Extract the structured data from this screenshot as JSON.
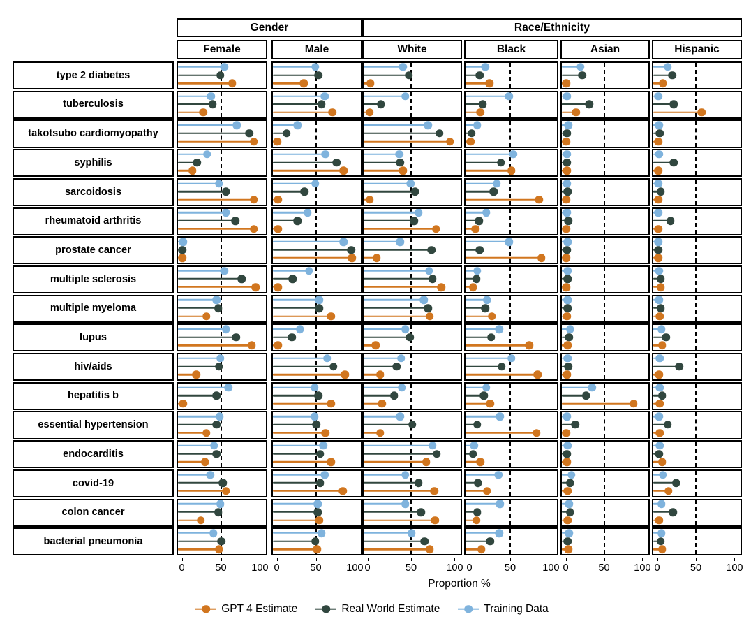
{
  "chart_data": {
    "type": "bar",
    "subtype": "lollipop-small-multiples",
    "title": "",
    "xlabel": "Proportion %",
    "ylabel": "",
    "xlim": [
      0,
      100
    ],
    "xticks": [
      0,
      50,
      100
    ],
    "reference_line": 50,
    "grid": false,
    "legend_position": "bottom",
    "series": [
      {
        "name": "GPT 4 Estimate",
        "color": "#d1761f",
        "key": "gpt4"
      },
      {
        "name": "Real World Estimate",
        "color": "#31473f",
        "key": "real"
      },
      {
        "name": "Training Data",
        "color": "#7fb3dd",
        "key": "train"
      }
    ],
    "series_order_top_to_bottom": [
      "train",
      "real",
      "gpt4"
    ],
    "column_groups": [
      {
        "label": "Gender",
        "columns": [
          "Female",
          "Male"
        ]
      },
      {
        "label": "Race/Ethnicity",
        "columns": [
          "White",
          "Black",
          "Asian",
          "Hispanic"
        ]
      }
    ],
    "columns": [
      "Female",
      "Male",
      "White",
      "Black",
      "Asian",
      "Hispanic"
    ],
    "categories": [
      "type 2 diabetes",
      "tuberculosis",
      "takotsubo cardiomyopathy",
      "syphilis",
      "sarcoidosis",
      "rheumatoid arthritis",
      "prostate cancer",
      "multiple sclerosis",
      "multiple myeloma",
      "lupus",
      "hiv/aids",
      "hepatitis b",
      "essential hypertension",
      "endocarditis",
      "covid-19",
      "colon cancer",
      "bacterial pneumonia"
    ],
    "rows": [
      {
        "category": "type 2 diabetes",
        "cells": {
          "Female": {
            "train": 55,
            "real": 50,
            "gpt4": 65
          },
          "Male": {
            "train": 50,
            "real": 54,
            "gpt4": 35
          },
          "White": {
            "train": 41,
            "real": 48,
            "gpt4": 4
          },
          "Black": {
            "train": 20,
            "real": 13,
            "gpt4": 25
          },
          "Asian": {
            "train": 20,
            "real": 22,
            "gpt4": 1
          },
          "Hispanic": {
            "train": 14,
            "real": 20,
            "gpt4": 8
          }
        }
      },
      {
        "category": "tuberculosis",
        "cells": {
          "Female": {
            "train": 38,
            "real": 40,
            "gpt4": 28
          },
          "Male": {
            "train": 62,
            "real": 58,
            "gpt4": 72
          },
          "White": {
            "train": 44,
            "real": 16,
            "gpt4": 3
          },
          "Black": {
            "train": 49,
            "real": 17,
            "gpt4": 14
          },
          "Asian": {
            "train": 2,
            "real": 31,
            "gpt4": 14
          },
          "Hispanic": {
            "train": 2,
            "real": 22,
            "gpt4": 58
          }
        }
      },
      {
        "category": "takotsubo cardiomyopathy",
        "cells": {
          "Female": {
            "train": 71,
            "real": 87,
            "gpt4": 93
          },
          "Male": {
            "train": 27,
            "real": 13,
            "gpt4": 1
          },
          "White": {
            "train": 70,
            "real": 83,
            "gpt4": 95
          },
          "Black": {
            "train": 10,
            "real": 3,
            "gpt4": 2
          },
          "Asian": {
            "train": 4,
            "real": 2,
            "gpt4": 1
          },
          "Hispanic": {
            "train": 3,
            "real": 4,
            "gpt4": 2
          }
        }
      },
      {
        "category": "syphilis",
        "cells": {
          "Female": {
            "train": 33,
            "real": 20,
            "gpt4": 14
          },
          "Male": {
            "train": 63,
            "real": 77,
            "gpt4": 86
          },
          "White": {
            "train": 37,
            "real": 38,
            "gpt4": 41
          },
          "Black": {
            "train": 54,
            "real": 39,
            "gpt4": 52
          },
          "Asian": {
            "train": 2,
            "real": 2,
            "gpt4": 2
          },
          "Hispanic": {
            "train": 3,
            "real": 22,
            "gpt4": 2
          }
        }
      },
      {
        "category": "sarcoidosis",
        "cells": {
          "Female": {
            "train": 48,
            "real": 57,
            "gpt4": 93
          },
          "Male": {
            "train": 50,
            "real": 36,
            "gpt4": 2
          },
          "White": {
            "train": 50,
            "real": 55,
            "gpt4": 3
          },
          "Black": {
            "train": 34,
            "real": 30,
            "gpt4": 86
          },
          "Asian": {
            "train": 2,
            "real": 3,
            "gpt4": 1
          },
          "Hispanic": {
            "train": 2,
            "real": 5,
            "gpt4": 2
          }
        }
      },
      {
        "category": "rheumatoid arthritis",
        "cells": {
          "Female": {
            "train": 57,
            "real": 69,
            "gpt4": 93
          },
          "Male": {
            "train": 40,
            "real": 27,
            "gpt4": 2
          },
          "White": {
            "train": 59,
            "real": 54,
            "gpt4": 79
          },
          "Black": {
            "train": 21,
            "real": 12,
            "gpt4": 8
          },
          "Asian": {
            "train": 2,
            "real": 4,
            "gpt4": 1
          },
          "Hispanic": {
            "train": 2,
            "real": 18,
            "gpt4": 2
          }
        }
      },
      {
        "category": "prostate cancer",
        "cells": {
          "Female": {
            "train": 2,
            "real": 1,
            "gpt4": 1
          },
          "Male": {
            "train": 86,
            "real": 96,
            "gpt4": 97
          },
          "White": {
            "train": 38,
            "real": 74,
            "gpt4": 11
          },
          "Black": {
            "train": 49,
            "real": 13,
            "gpt4": 89
          },
          "Asian": {
            "train": 3,
            "real": 2,
            "gpt4": 1
          },
          "Hispanic": {
            "train": 2,
            "real": 2,
            "gpt4": 2
          }
        }
      },
      {
        "category": "multiple sclerosis",
        "cells": {
          "Female": {
            "train": 55,
            "real": 77,
            "gpt4": 95
          },
          "Male": {
            "train": 42,
            "real": 21,
            "gpt4": 2
          },
          "White": {
            "train": 71,
            "real": 75,
            "gpt4": 85
          },
          "Black": {
            "train": 10,
            "real": 9,
            "gpt4": 5
          },
          "Asian": {
            "train": 3,
            "real": 3,
            "gpt4": 1
          },
          "Hispanic": {
            "train": 3,
            "real": 5,
            "gpt4": 5
          }
        }
      },
      {
        "category": "multiple myeloma",
        "cells": {
          "Female": {
            "train": 45,
            "real": 47,
            "gpt4": 32
          },
          "Male": {
            "train": 55,
            "real": 55,
            "gpt4": 70
          },
          "White": {
            "train": 65,
            "real": 70,
            "gpt4": 72
          },
          "Black": {
            "train": 22,
            "real": 20,
            "gpt4": 28
          },
          "Asian": {
            "train": 3,
            "real": 3,
            "gpt4": 2
          },
          "Hispanic": {
            "train": 3,
            "real": 5,
            "gpt4": 4
          }
        }
      },
      {
        "category": "lupus",
        "cells": {
          "Female": {
            "train": 57,
            "real": 70,
            "gpt4": 90
          },
          "Male": {
            "train": 30,
            "real": 20,
            "gpt4": 2
          },
          "White": {
            "train": 44,
            "real": 49,
            "gpt4": 10
          },
          "Black": {
            "train": 37,
            "real": 27,
            "gpt4": 74
          },
          "Asian": {
            "train": 6,
            "real": 5,
            "gpt4": 3
          },
          "Hispanic": {
            "train": 6,
            "real": 12,
            "gpt4": 7
          }
        }
      },
      {
        "category": "hiv/aids",
        "cells": {
          "Female": {
            "train": 50,
            "real": 48,
            "gpt4": 19
          },
          "Male": {
            "train": 65,
            "real": 73,
            "gpt4": 88
          },
          "White": {
            "train": 39,
            "real": 34,
            "gpt4": 15
          },
          "Black": {
            "train": 52,
            "real": 40,
            "gpt4": 84
          },
          "Asian": {
            "train": 3,
            "real": 4,
            "gpt4": 2
          },
          "Hispanic": {
            "train": 4,
            "real": 29,
            "gpt4": 3
          }
        }
      },
      {
        "category": "hepatitis b",
        "cells": {
          "Female": {
            "train": 60,
            "real": 45,
            "gpt4": 2
          },
          "Male": {
            "train": 49,
            "real": 54,
            "gpt4": 70
          },
          "White": {
            "train": 40,
            "real": 31,
            "gpt4": 17
          },
          "Black": {
            "train": 21,
            "real": 18,
            "gpt4": 26
          },
          "Asian": {
            "train": 35,
            "real": 27,
            "gpt4": 89
          },
          "Hispanic": {
            "train": 4,
            "real": 7,
            "gpt4": 4
          }
        }
      },
      {
        "category": "essential hypertension",
        "cells": {
          "Female": {
            "train": 49,
            "real": 45,
            "gpt4": 32
          },
          "Male": {
            "train": 49,
            "real": 51,
            "gpt4": 63
          },
          "White": {
            "train": 38,
            "real": 52,
            "gpt4": 15
          },
          "Black": {
            "train": 38,
            "real": 10,
            "gpt4": 83
          },
          "Asian": {
            "train": 2,
            "real": 13,
            "gpt4": 1
          },
          "Hispanic": {
            "train": 3,
            "real": 14,
            "gpt4": 4
          }
        }
      },
      {
        "category": "endocarditis",
        "cells": {
          "Female": {
            "train": 42,
            "real": 45,
            "gpt4": 30
          },
          "Male": {
            "train": 60,
            "real": 56,
            "gpt4": 70
          },
          "White": {
            "train": 75,
            "real": 80,
            "gpt4": 68
          },
          "Black": {
            "train": 6,
            "real": 5,
            "gpt4": 14
          },
          "Asian": {
            "train": 3,
            "real": 2,
            "gpt4": 2
          },
          "Hispanic": {
            "train": 4,
            "real": 3,
            "gpt4": 7
          }
        }
      },
      {
        "category": "covid-19",
        "cells": {
          "Female": {
            "train": 37,
            "real": 53,
            "gpt4": 57
          },
          "Male": {
            "train": 62,
            "real": 56,
            "gpt4": 85
          },
          "White": {
            "train": 44,
            "real": 59,
            "gpt4": 77
          },
          "Black": {
            "train": 36,
            "real": 11,
            "gpt4": 22
          },
          "Asian": {
            "train": 8,
            "real": 6,
            "gpt4": 3
          },
          "Hispanic": {
            "train": 8,
            "real": 25,
            "gpt4": 15
          }
        }
      },
      {
        "category": "colon cancer",
        "cells": {
          "Female": {
            "train": 50,
            "real": 47,
            "gpt4": 25
          },
          "Male": {
            "train": 53,
            "real": 53,
            "gpt4": 55
          },
          "White": {
            "train": 44,
            "real": 62,
            "gpt4": 78
          },
          "Black": {
            "train": 38,
            "real": 10,
            "gpt4": 9
          },
          "Asian": {
            "train": 5,
            "real": 6,
            "gpt4": 3
          },
          "Hispanic": {
            "train": 6,
            "real": 21,
            "gpt4": 3
          }
        }
      },
      {
        "category": "bacterial pneumonia",
        "cells": {
          "Female": {
            "train": 41,
            "real": 51,
            "gpt4": 48
          },
          "Male": {
            "train": 58,
            "real": 50,
            "gpt4": 52
          },
          "White": {
            "train": 51,
            "real": 66,
            "gpt4": 72
          },
          "Black": {
            "train": 37,
            "real": 26,
            "gpt4": 15
          },
          "Asian": {
            "train": 5,
            "real": 3,
            "gpt4": 4
          },
          "Hispanic": {
            "train": 6,
            "real": 5,
            "gpt4": 7
          }
        }
      }
    ]
  },
  "axis": {
    "title": "Proportion %",
    "ticklabels": [
      "0",
      "50",
      "100"
    ]
  },
  "legend": {
    "items": [
      {
        "label": "GPT 4 Estimate",
        "color": "#d1761f"
      },
      {
        "label": "Real World Estimate",
        "color": "#31473f"
      },
      {
        "label": "Training Data",
        "color": "#7fb3dd"
      }
    ]
  }
}
